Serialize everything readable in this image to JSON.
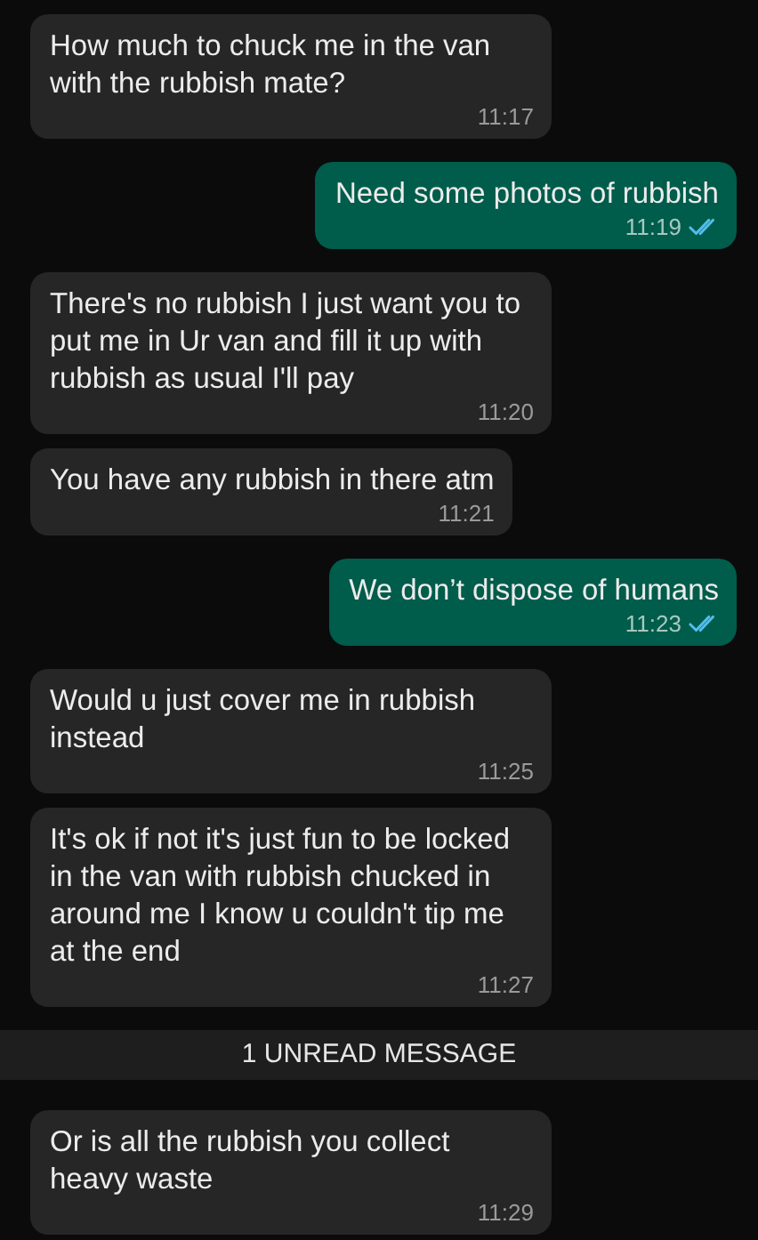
{
  "messages": [
    {
      "kind": "incoming",
      "text": "How much to chuck me in the van with the rubbish mate?",
      "time": "11:17"
    },
    {
      "kind": "outgoing",
      "text": "Need some photos of rubbish",
      "time": "11:19",
      "read": true
    },
    {
      "kind": "incoming",
      "text": "There's no rubbish I just want you to put me in Ur van and fill it up with rubbish as usual I'll pay",
      "time": "11:20"
    },
    {
      "kind": "incoming",
      "text": "You have any rubbish in there atm",
      "time": "11:21"
    },
    {
      "kind": "outgoing",
      "text": "We don’t dispose of humans",
      "time": "11:23",
      "read": true
    },
    {
      "kind": "incoming",
      "text": "Would u just cover me in rubbish instead",
      "time": "11:25"
    },
    {
      "kind": "incoming",
      "text": "It's ok if not it's just fun to be locked in the van with rubbish chucked in around me I know u couldn't tip me at the end",
      "time": "11:27"
    },
    {
      "kind": "divider",
      "text": "1 UNREAD MESSAGE"
    },
    {
      "kind": "incoming",
      "text": "Or is all the rubbish you collect heavy waste",
      "time": "11:29"
    }
  ]
}
